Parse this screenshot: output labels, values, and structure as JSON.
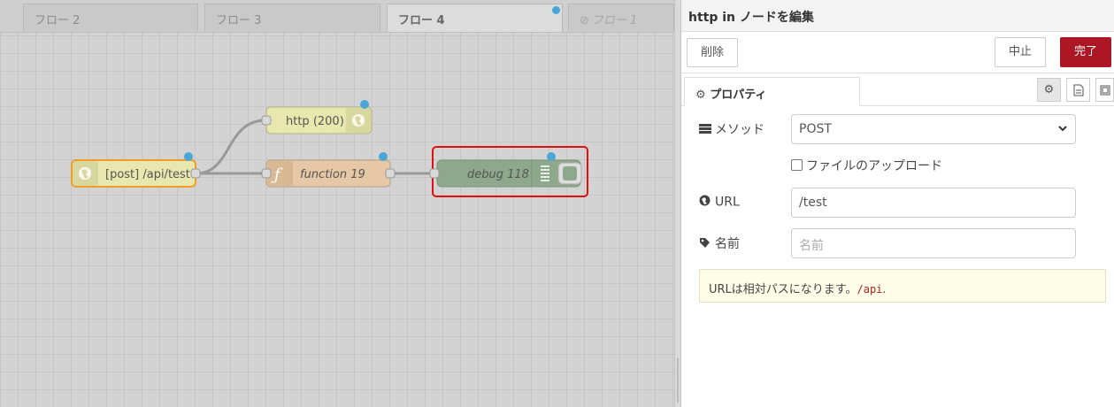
{
  "workspace": {
    "tabs": [
      {
        "label": "フロー 2"
      },
      {
        "label": "フロー 3"
      },
      {
        "label": "フロー 4"
      },
      {
        "label": "フロー 1"
      }
    ],
    "nodes": {
      "http_in": "[post] /api/test",
      "http_response": "http (200)",
      "function": "function 19",
      "debug": "debug 118"
    }
  },
  "editor": {
    "title": "http in ノードを編集",
    "buttons": {
      "delete": "削除",
      "cancel": "中止",
      "done": "完了"
    },
    "tabs": {
      "properties": "プロパティ"
    },
    "fields": {
      "method": {
        "label": "メソッド",
        "value": "POST"
      },
      "upload": {
        "label": "ファイルのアップロード"
      },
      "url": {
        "label": "URL",
        "value": "/test"
      },
      "name": {
        "label": "名前",
        "placeholder": "名前"
      }
    },
    "tip": {
      "text": "URLは相対パスになります。",
      "code": "/api",
      "suffix": "."
    }
  },
  "colors": {
    "accent_red": "#ad1625",
    "port_blue": "#4aa6d6",
    "highlight_red": "#e01010"
  }
}
